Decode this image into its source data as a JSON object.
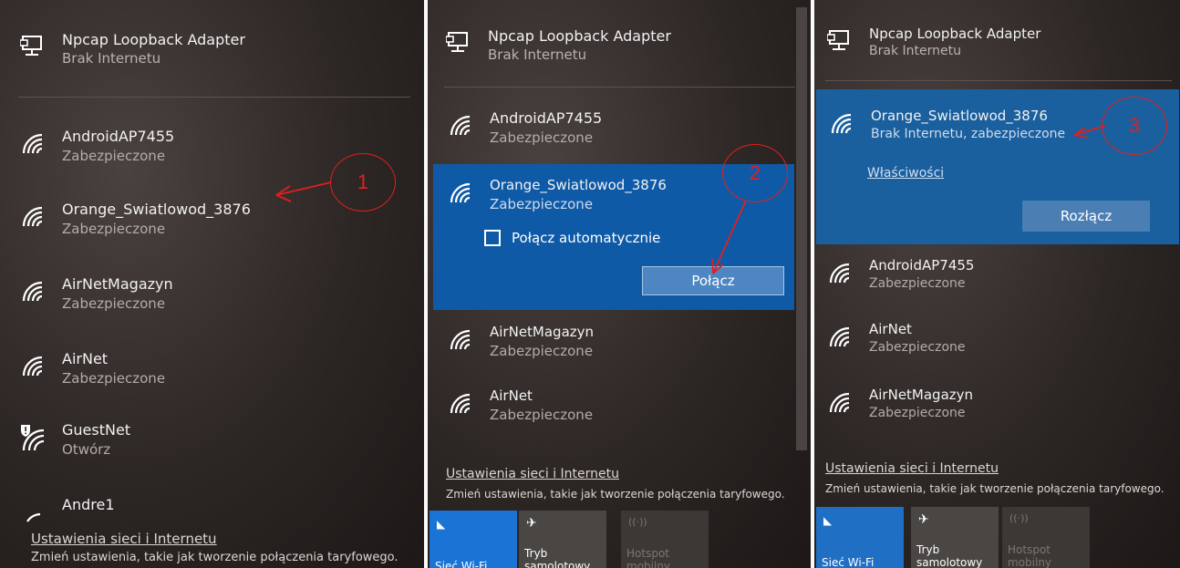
{
  "adapter": {
    "name": "Npcap Loopback Adapter",
    "status": "Brak Internetu"
  },
  "panel1": {
    "networks": [
      {
        "name": "AndroidAP7455",
        "status": "Zabezpieczone"
      },
      {
        "name": "Orange_Swiatlowod_3876",
        "status": "Zabezpieczone"
      },
      {
        "name": "AirNetMagazyn",
        "status": "Zabezpieczone"
      },
      {
        "name": "AirNet",
        "status": "Zabezpieczone"
      },
      {
        "name": "GuestNet",
        "status": "Otwórz"
      },
      {
        "name": "Andre1",
        "status": ""
      }
    ]
  },
  "panel2": {
    "networks": [
      {
        "name": "AndroidAP7455",
        "status": "Zabezpieczone"
      },
      {
        "name": "Orange_Swiatlowod_3876",
        "status": "Zabezpieczone"
      },
      {
        "name": "AirNetMagazyn",
        "status": "Zabezpieczone"
      },
      {
        "name": "AirNet",
        "status": "Zabezpieczone"
      }
    ],
    "auto_connect_label": "Połącz automatycznie",
    "connect_label": "Połącz"
  },
  "panel3": {
    "networks": [
      {
        "name": "Orange_Swiatlowod_3876",
        "status": "Brak Internetu, zabezpieczone"
      },
      {
        "name": "AndroidAP7455",
        "status": "Zabezpieczone"
      },
      {
        "name": "AirNet",
        "status": "Zabezpieczone"
      },
      {
        "name": "AirNetMagazyn",
        "status": "Zabezpieczone"
      }
    ],
    "properties_label": "Właściwości",
    "disconnect_label": "Rozłącz"
  },
  "footer": {
    "settings_link": "Ustawienia sieci i Internetu",
    "settings_desc": "Zmień ustawienia, takie jak tworzenie połączenia taryfowego."
  },
  "quick_actions": {
    "wifi": "Sieć Wi-Fi",
    "airplane_l1": "Tryb",
    "airplane_l2": "samolotowy",
    "hotspot_l1": "Hotspot",
    "hotspot_l2": "mobilny"
  },
  "annotations": {
    "step1": "1",
    "step2": "2",
    "step3": "3"
  },
  "colors": {
    "accent": "#0f5aa6",
    "annotation": "#e0201f",
    "quick_tile_on": "#1a74d6"
  }
}
